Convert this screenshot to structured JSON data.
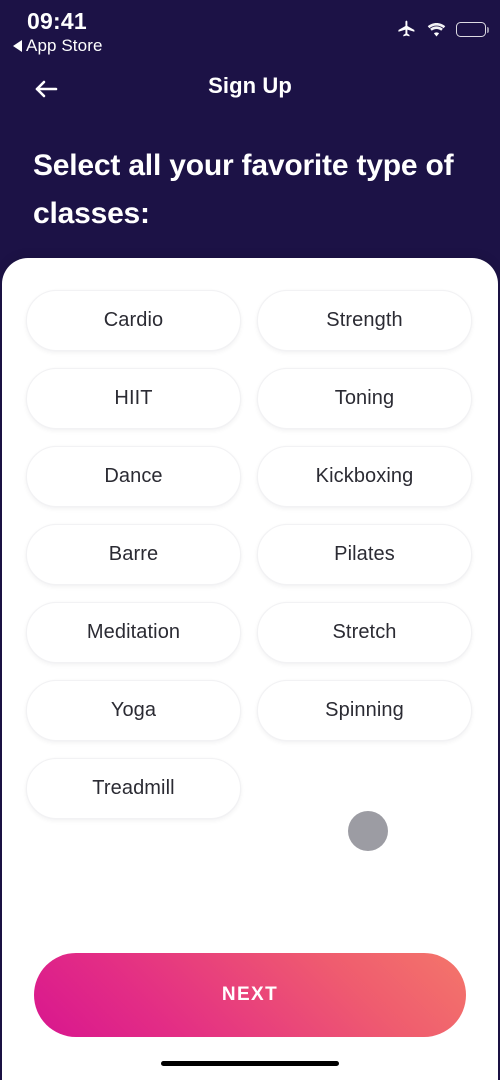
{
  "status_bar": {
    "time": "09:41",
    "back_label": "App Store",
    "back_triangle_icon": "triangle-left-icon",
    "airplane_icon": "airplane-mode-icon",
    "wifi_icon": "wifi-icon",
    "battery_icon": "battery-icon",
    "battery_color": "#ffd60a"
  },
  "nav_bar": {
    "title": "Sign Up",
    "back_icon": "arrow-left-icon"
  },
  "headline": {
    "text": "Select all your favorite type of classes:"
  },
  "theme": {
    "header_background": "#1c1246",
    "sheet_background": "#ffffff",
    "chip_text": "#2b2b33",
    "chip_border": "#f2f2f4",
    "gradient_start": "#d8168f",
    "gradient_end": "#f4766a",
    "cursor_color": "#9c9ca3"
  },
  "chips": [
    {
      "label": "Cardio",
      "selected": false
    },
    {
      "label": "Strength",
      "selected": false
    },
    {
      "label": "HIIT",
      "selected": false
    },
    {
      "label": "Toning",
      "selected": false
    },
    {
      "label": "Dance",
      "selected": false
    },
    {
      "label": "Kickboxing",
      "selected": false
    },
    {
      "label": "Barre",
      "selected": false
    },
    {
      "label": "Pilates",
      "selected": false
    },
    {
      "label": "Meditation",
      "selected": false
    },
    {
      "label": "Stretch",
      "selected": false
    },
    {
      "label": "Yoga",
      "selected": false
    },
    {
      "label": "Spinning",
      "selected": false
    },
    {
      "label": "Treadmill",
      "selected": false
    }
  ],
  "cursor": {
    "name": "cursor-indicator"
  },
  "next_button": {
    "label": "NEXT"
  },
  "home_indicator": {
    "name": "home-indicator"
  }
}
